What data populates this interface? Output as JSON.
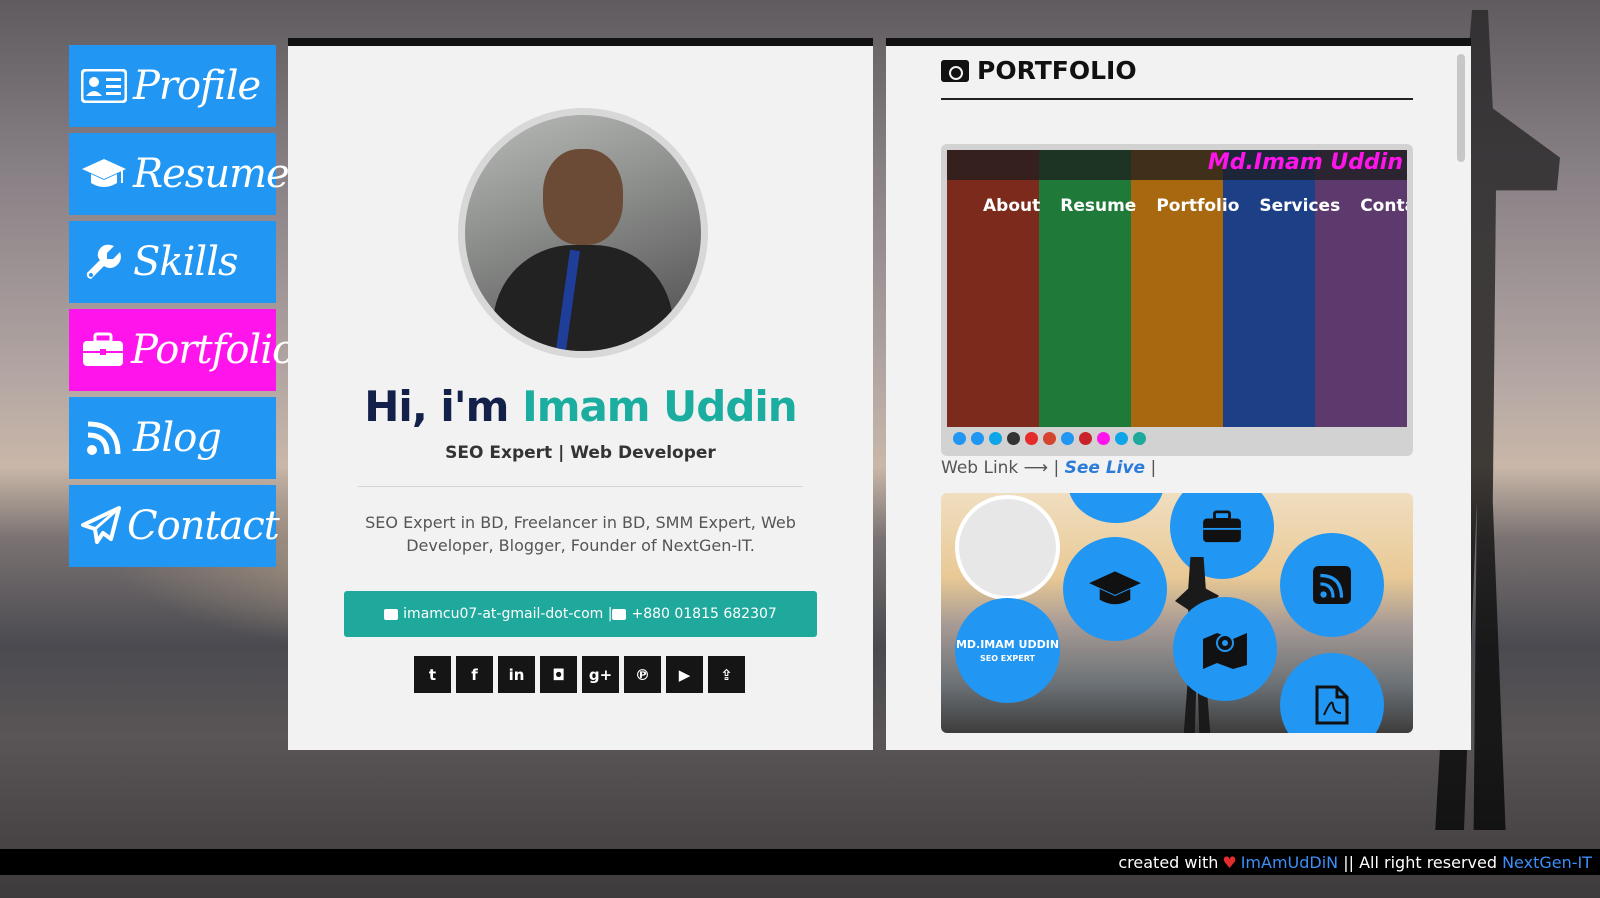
{
  "nav": {
    "items": [
      {
        "label": "Profile",
        "icon": "id-card-icon",
        "active": false
      },
      {
        "label": "Resume",
        "icon": "graduation-cap-icon",
        "active": false
      },
      {
        "label": "Skills",
        "icon": "wrench-icon",
        "active": false
      },
      {
        "label": "Portfolio",
        "icon": "briefcase-icon",
        "active": true
      },
      {
        "label": "Blog",
        "icon": "rss-icon",
        "active": false
      },
      {
        "label": "Contact",
        "icon": "paper-plane-icon",
        "active": false
      }
    ],
    "colors": {
      "default": "#2196f3",
      "active": "#ff14ec"
    }
  },
  "profile": {
    "greeting_prefix": "Hi, i'm",
    "name": "Imam Uddin",
    "role": "SEO Expert | Web Developer",
    "bio": "SEO Expert in BD, Freelancer in BD, SMM Expert, Web Developer, Blogger, Founder of NextGen-IT.",
    "contact_text": "imamcu07-at-gmail-dot-com | ",
    "phone_text": "+880 01815 682307",
    "socials": [
      {
        "icon": "twitter-icon",
        "glyph": "t"
      },
      {
        "icon": "facebook-icon",
        "glyph": "f"
      },
      {
        "icon": "linkedin-icon",
        "glyph": "in"
      },
      {
        "icon": "instagram-icon",
        "glyph": "◘"
      },
      {
        "icon": "google-plus-icon",
        "glyph": "g+"
      },
      {
        "icon": "pinterest-icon",
        "glyph": "℗"
      },
      {
        "icon": "youtube-icon",
        "glyph": "▶"
      },
      {
        "icon": "share-icon",
        "glyph": "⇪"
      }
    ],
    "accent": "#1aada0"
  },
  "portfolio": {
    "title": "PORTFOLIO",
    "shot1": {
      "brand": "Md.Imam Uddin",
      "menu": [
        "About",
        "Resume",
        "Portfolio",
        "Services",
        "Contact"
      ]
    },
    "web_link_prefix": "Web Link ⟶ | ",
    "see_live": "See Live",
    "web_link_suffix": " |",
    "shot2": {
      "name": "MD.IMAM UDDIN",
      "subtitle": "SEO EXPERT"
    }
  },
  "footer": {
    "created_with": "created with",
    "author": "ImAmUdDiN",
    "rights": " || All right reserved ",
    "company": "NextGen-IT"
  }
}
